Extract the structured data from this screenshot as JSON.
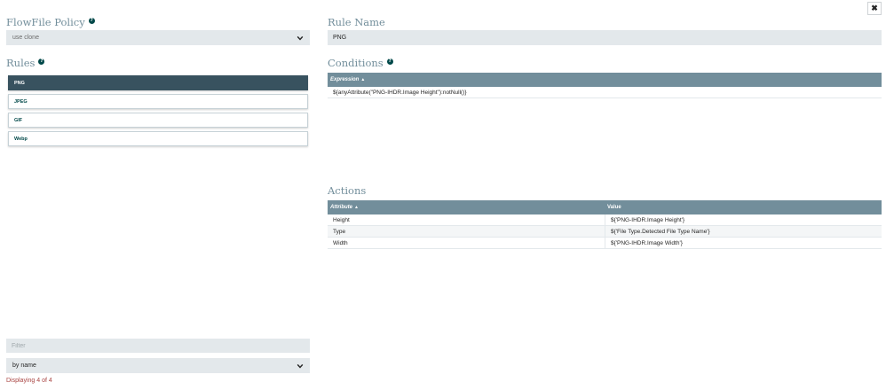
{
  "flowfile_policy": {
    "title": "FlowFile Policy",
    "value": "use clone"
  },
  "rule_name": {
    "title": "Rule Name",
    "value": "PNG"
  },
  "rules": {
    "title": "Rules",
    "items": [
      {
        "label": "PNG",
        "selected": true
      },
      {
        "label": "JPEG",
        "selected": false
      },
      {
        "label": "GIF",
        "selected": false
      },
      {
        "label": "Webp",
        "selected": false
      }
    ]
  },
  "conditions": {
    "title": "Conditions",
    "column_expression": "Expression",
    "rows": [
      {
        "expression": "${anyAttribute(\"PNG-IHDR.Image Height\"):notNull()}"
      }
    ]
  },
  "actions": {
    "title": "Actions",
    "column_attribute": "Attribute",
    "column_value": "Value",
    "rows": [
      {
        "attribute": "Height",
        "value": "${'PNG-IHDR.Image Height'}"
      },
      {
        "attribute": "Type",
        "value": "${'File Type.Detected File Type Name'}"
      },
      {
        "attribute": "Width",
        "value": "${'PNG-IHDR.Image Width'}"
      }
    ]
  },
  "filter": {
    "placeholder": "Filter",
    "sort_value": "by name",
    "status": "Displaying 4 of 4"
  },
  "icons": {
    "help": "?",
    "close": "✖",
    "sort": "▲"
  },
  "colors": {
    "heading": "#728e9b",
    "selected_rule": "#38525f",
    "grid_header": "#728e9b",
    "status": "#a94442"
  }
}
